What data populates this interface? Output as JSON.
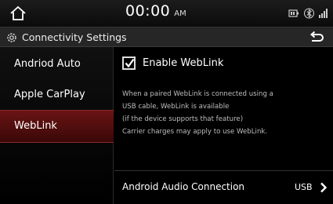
{
  "status_bar": {
    "time": "00:00",
    "ampm": "AM"
  },
  "header": {
    "title": "Connectivity Settings"
  },
  "sidebar": {
    "items": [
      {
        "label": "Andriod Auto"
      },
      {
        "label": "Apple CarPlay"
      },
      {
        "label": "WebLink",
        "selected": true
      }
    ]
  },
  "content": {
    "enable_checkbox": {
      "label": "Enable WebLink",
      "checked": true
    },
    "description_lines": [
      "When a paired WebLink is connected using a",
      "USB cable, WebLink is available",
      "(if the device supports that feature)",
      "Carrier charges may apply to use WebLink."
    ],
    "audio_connection": {
      "label": "Android Audio Connection",
      "value": "USB"
    }
  },
  "colors": {
    "selected_item_bg": "#5a1010",
    "background": "#000000",
    "header_bg": "#262626"
  }
}
